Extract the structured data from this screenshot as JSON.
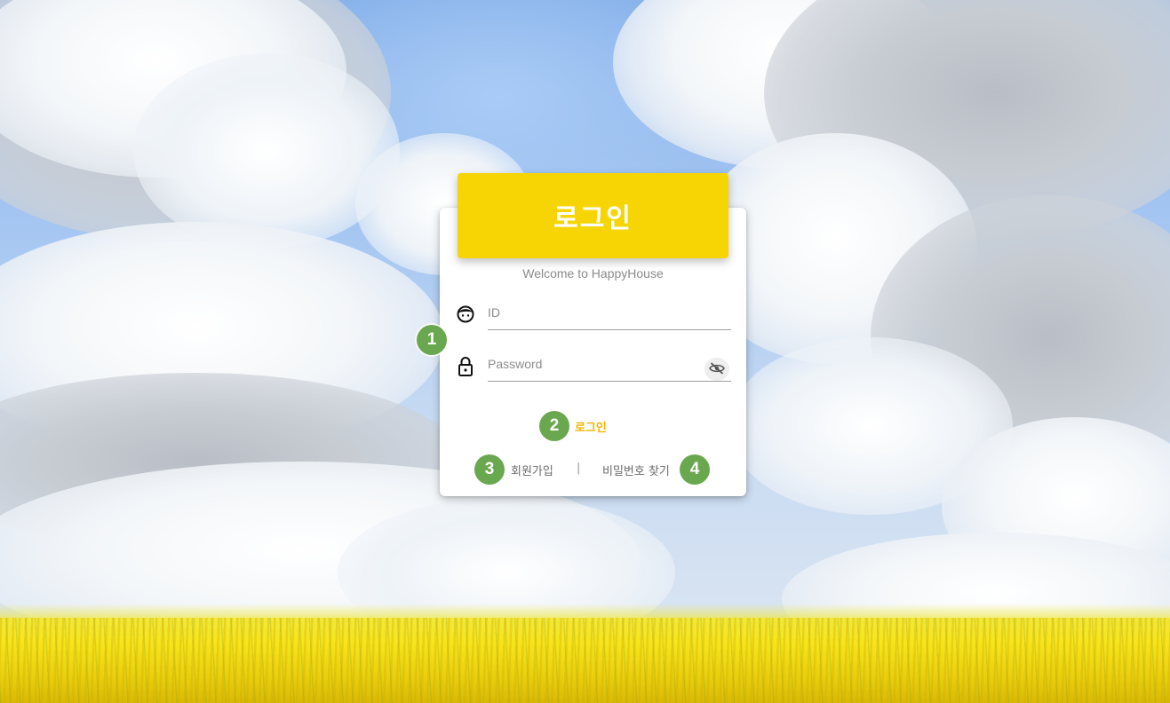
{
  "login_header": {
    "title": "로그인"
  },
  "welcome_text": "Welcome to HappyHouse",
  "id_field": {
    "placeholder": "ID",
    "value": "",
    "icon": "face-icon"
  },
  "password_field": {
    "placeholder": "Password",
    "value": "",
    "icon": "lock-icon",
    "toggle_icon": "eye-off-icon"
  },
  "login_link": "로그인",
  "signup_link": "회원가입",
  "separator": "|",
  "find_password_link": "비밀번호 찾기",
  "markers": [
    "1",
    "2",
    "3",
    "4"
  ],
  "colors": {
    "header": "#f7d505",
    "login_link": "#f4b400",
    "marker": "#6aa84f",
    "card": "#ffffff"
  }
}
